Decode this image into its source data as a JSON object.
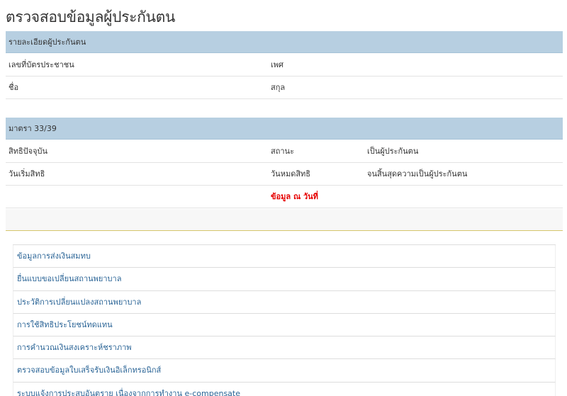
{
  "page": {
    "title": "ตรวจสอบข้อมูลผู้ประกันตน"
  },
  "insured_details": {
    "header": "รายละเอียดผู้ประกันตน",
    "id_card_label": "เลขที่บัตรประชาชน",
    "gender_label": "เพศ",
    "first_name_label": "ชื่อ",
    "last_name_label": "สกุล"
  },
  "section_3339": {
    "header": "มาตรา 33/39",
    "rights_label": "สิทธิปัจจุบัน",
    "status_label": "สถานะ",
    "status_value": "เป็นผู้ประกันตน",
    "start_label": "วันเริ่มสิทธิ",
    "end_label": "วันหมดสิทธิ",
    "end_value": "จนสิ้นสุดความเป็นผู้ประกันตน",
    "as_of_label": "ข้อมูล ณ วันที่"
  },
  "links": [
    "ข้อมูลการส่งเงินสมทบ",
    "ยื่นแบบขอเปลี่ยนสถานพยาบาล",
    "ประวัติการเปลี่ยนแปลงสถานพยาบาล",
    "การใช้สิทธิประโยชน์ทดแทน",
    "การคำนวณเงินสงเคราะห์ชราภาพ",
    "ตรวจสอบข้อมูลใบเสร็จรับเงินอิเล็กทรอนิกส์",
    "ระบบแจ้งการประสบอันตราย เนื่องจากการทำงาน e-compensate"
  ],
  "colors": {
    "header_bg": "#b7cfe1",
    "link": "#2a6496",
    "alert": "#e60000",
    "divider": "#d6c56a"
  }
}
